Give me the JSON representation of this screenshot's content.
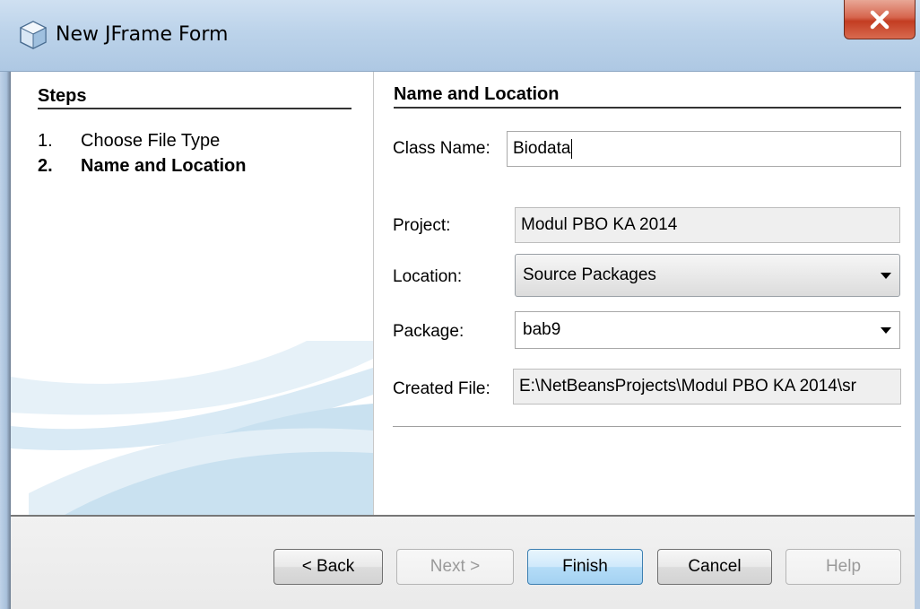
{
  "window": {
    "title": "New JFrame Form",
    "close_symbol": "X",
    "icon": "netbeans-cube-icon"
  },
  "steps": {
    "heading": "Steps",
    "items": [
      {
        "num": "1.",
        "label": "Choose File Type",
        "current": false
      },
      {
        "num": "2.",
        "label": "Name and Location",
        "current": true
      }
    ]
  },
  "form": {
    "heading": "Name and Location",
    "class_name": {
      "label": "Class Name:",
      "value": "Biodata"
    },
    "project": {
      "label": "Project:",
      "value": "Modul PBO KA 2014"
    },
    "location": {
      "label": "Location:",
      "value": "Source Packages"
    },
    "package": {
      "label": "Package:",
      "value": "bab9"
    },
    "created_file": {
      "label": "Created File:",
      "value": "E:\\NetBeansProjects\\Modul PBO KA 2014\\sr"
    }
  },
  "buttons": {
    "back": "< Back",
    "next": "Next >",
    "finish": "Finish",
    "cancel": "Cancel",
    "help": "Help"
  },
  "colors": {
    "titlebar": "#bcd3ea",
    "close": "#c8432a",
    "primary_button": "#b4dcf7",
    "swoosh": "#cfe6f3"
  }
}
